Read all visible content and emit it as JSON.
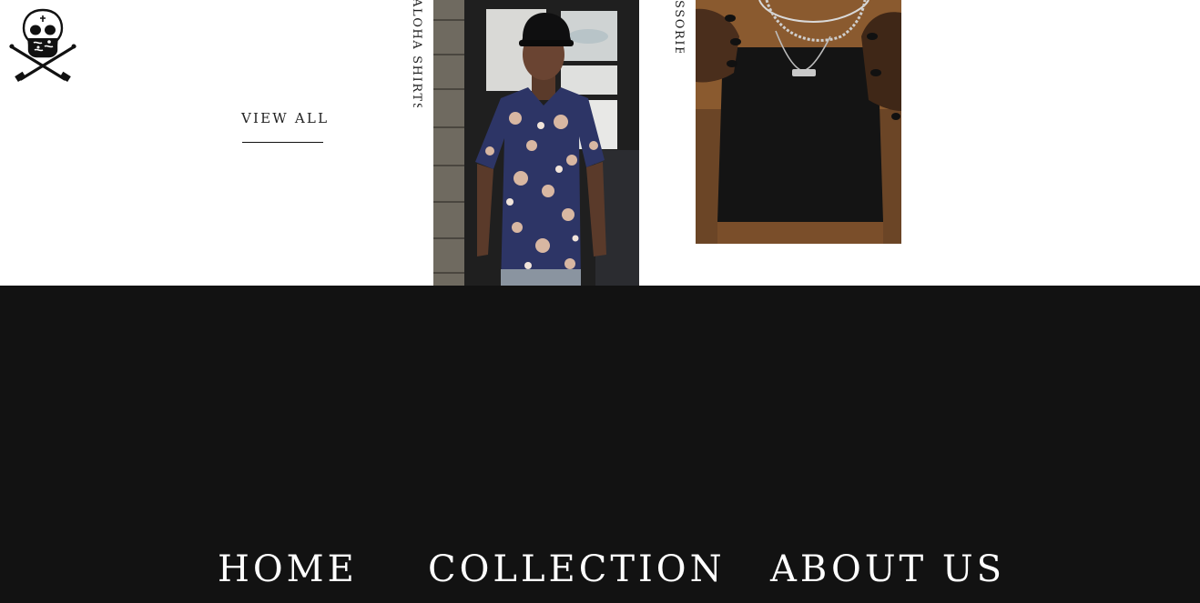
{
  "header": {
    "logo_icon": "skull-crossed-swords-icon"
  },
  "collection": {
    "view_all_label": "VIEW ALL",
    "aloha_label": "ALOHA SHIRTS",
    "accessories_label": "SSORIES"
  },
  "footer": {
    "nav": [
      {
        "label": "HOME"
      },
      {
        "label": "COLLECTION"
      },
      {
        "label": "ABOUT US"
      }
    ]
  },
  "colors": {
    "footer_bg": "#121212",
    "nav_text": "#ffffff",
    "page_bg": "#ffffff"
  }
}
